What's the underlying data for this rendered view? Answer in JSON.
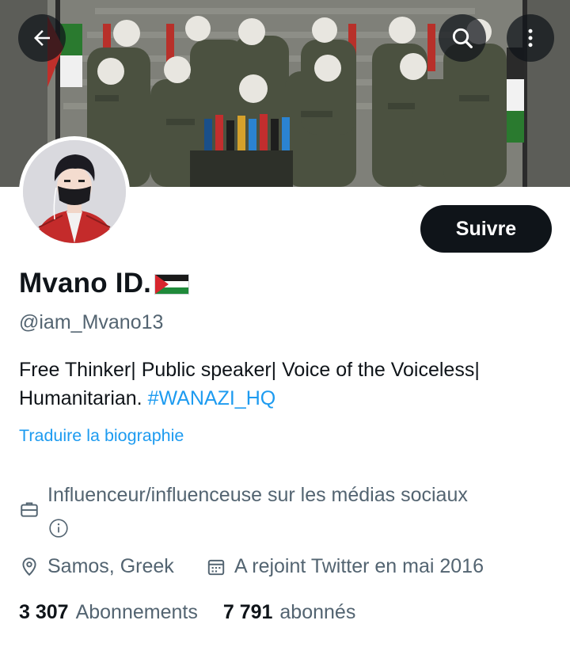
{
  "profile": {
    "display_name": "Mvano ID.",
    "flag_emoji": "🇵🇸",
    "handle": "@iam_Mvano13",
    "bio_text": "Free Thinker| Public speaker| Voice of the Voiceless| Humanitarian.",
    "bio_hashtag": "#WANAZI_HQ",
    "translate_label": "Traduire la biographie",
    "category": "Influenceur/influenceuse sur les médias sociaux",
    "location": "Samos, Greek",
    "joined": "A rejoint Twitter en mai 2016"
  },
  "stats": {
    "following_count": "3 307",
    "following_label": "Abonnements",
    "followers_count": "7 791",
    "followers_label": "abonnés"
  },
  "actions": {
    "follow_label": "Suivre"
  },
  "icons": {
    "back": "arrow-left-icon",
    "search": "search-icon",
    "more": "more-vertical-icon",
    "category": "briefcase-icon",
    "info": "info-icon",
    "location": "location-pin-icon",
    "calendar": "calendar-icon"
  },
  "colors": {
    "accent": "#1d9bf0",
    "text_primary": "#0f1419",
    "text_secondary": "#536471",
    "button_bg": "#0f1419"
  }
}
